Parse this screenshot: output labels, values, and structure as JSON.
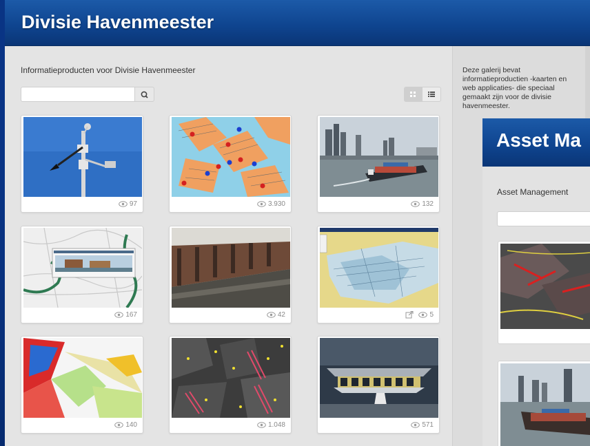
{
  "header": {
    "title": "Divisie Havenmeester"
  },
  "main": {
    "subtitle": "Informatieproducten voor Divisie Havenmeester",
    "search": {
      "value": "",
      "placeholder": ""
    },
    "cards": [
      {
        "name": "weather-station",
        "views": "97",
        "external": false
      },
      {
        "name": "berth-map",
        "views": "3.930",
        "external": false
      },
      {
        "name": "container-ship",
        "views": "132",
        "external": false
      },
      {
        "name": "city-map-app",
        "views": "167",
        "external": false
      },
      {
        "name": "quay-wall",
        "views": "42",
        "external": false
      },
      {
        "name": "nautical-chart-viewer",
        "views": "5",
        "external": true
      },
      {
        "name": "zoning-map",
        "views": "140",
        "external": false
      },
      {
        "name": "dark-harbour-map",
        "views": "1.048",
        "external": false
      },
      {
        "name": "harbour-building",
        "views": "571",
        "external": false
      }
    ]
  },
  "sidebar": {
    "description": "Deze galerij bevat informatieproductien -kaarten en web applicaties- die speciaal gemaakt zijn voor de divisie havenmeester."
  },
  "overlay": {
    "title": "Asset Ma",
    "subtitle": "Asset Management",
    "search": {
      "value": "",
      "placeholder": ""
    }
  },
  "icons": {
    "search": "search-icon",
    "grid_view": "grid-view-icon",
    "list_view": "list-view-icon",
    "views": "eye-icon",
    "external": "external-link-icon"
  },
  "colors": {
    "header_blue": "#0f4590",
    "panel_bg": "#e4e4e4",
    "sidebar_bg": "#dcdcdc",
    "meta_text": "#8a8a8a"
  }
}
